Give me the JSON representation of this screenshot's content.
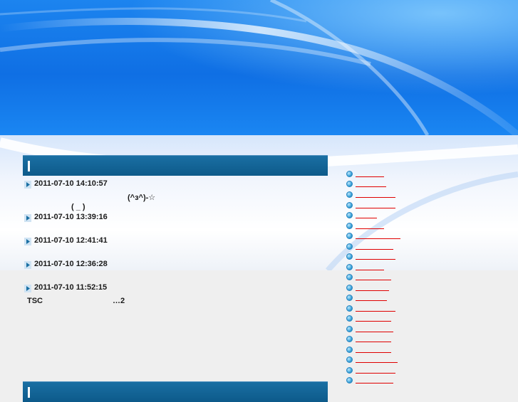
{
  "entries": [
    {
      "date": "2011-07-10 14:10:57",
      "lines": [
        "(^з^)-☆",
        "( _ )"
      ]
    },
    {
      "date": "2011-07-10 13:39:16",
      "lines": []
    },
    {
      "date": "2011-07-10 12:41:41",
      "lines": []
    },
    {
      "date": "2011-07-10 12:36:28",
      "lines": []
    },
    {
      "date": "2011-07-10 11:52:15",
      "lines": [
        "TSC",
        "…2"
      ]
    }
  ],
  "sidebar": {
    "link_count": 21,
    "link_color": "#e00000"
  },
  "colors": {
    "header_bar": "#0d5a8a",
    "sky_blue": "#0f6fe4"
  }
}
